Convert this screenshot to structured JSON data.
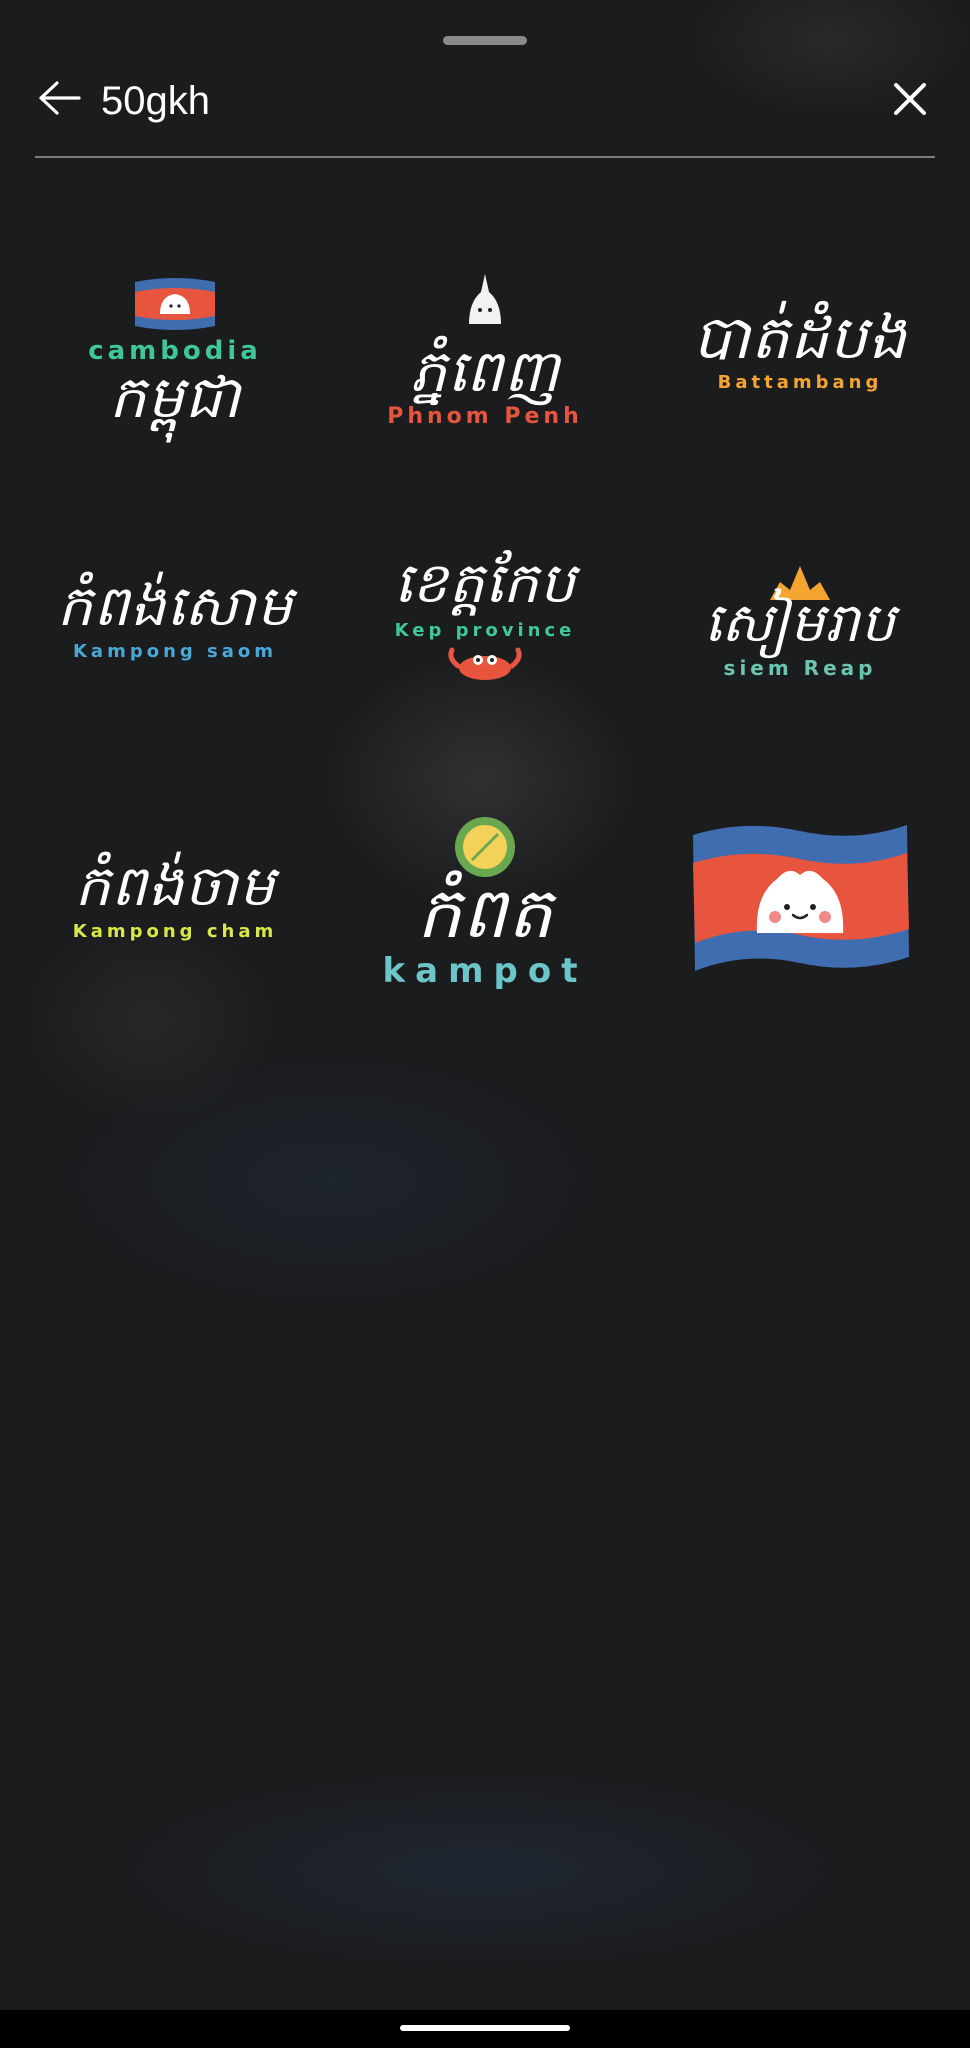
{
  "search": {
    "value": "50gkh"
  },
  "icons": {
    "back": "arrow-left-icon",
    "close": "close-x-icon"
  },
  "stickers": [
    {
      "khmer": "កម្ពុជា",
      "latin": "cambodia",
      "latin_color": "#3fc79a"
    },
    {
      "khmer": "ភ្នំពេញ",
      "latin": "Phnom Penh",
      "latin_color": "#e8553e"
    },
    {
      "khmer": "បាត់ដំបង",
      "latin": "Battambang",
      "latin_color": "#f4a531"
    },
    {
      "khmer": "កំពង់សោម",
      "latin": "Kampong saom",
      "latin_color": "#4aa8d8"
    },
    {
      "khmer": "ខេត្តកែប",
      "latin": "Kep province",
      "latin_color": "#3fc79a"
    },
    {
      "khmer": "សៀមរាប",
      "latin": "siem Reap",
      "latin_color": "#6cc5b0"
    },
    {
      "khmer": "កំពង់ចាម",
      "latin": "Kampong cham",
      "latin_color": "#d8e84a"
    },
    {
      "khmer": "កំពត",
      "latin": "kampot",
      "latin_color": "#6cc5c8"
    }
  ],
  "colors": {
    "flag_red": "#e8553e",
    "flag_blue": "#3f6db0",
    "crab": "#e8553e",
    "orange": "#f4a531",
    "durian_green": "#6aa84f",
    "durian_yellow": "#f4d25a"
  }
}
